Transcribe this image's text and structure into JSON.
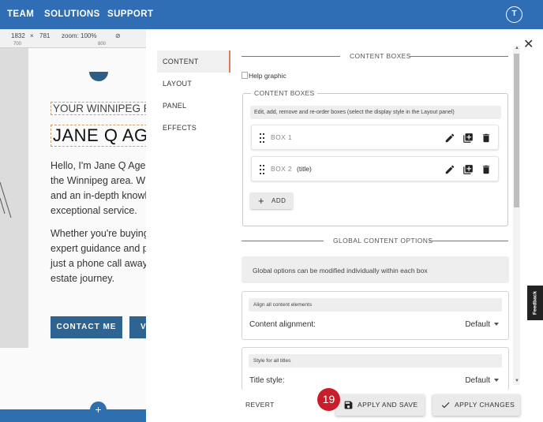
{
  "topnav": {
    "items": [
      "TEAM",
      "SOLUTIONS",
      "SUPPORT"
    ],
    "avatar": "T"
  },
  "editor_toolbar": {
    "width": "1832",
    "height": "781",
    "zoom": "zoom: 100%",
    "ruler_marks": [
      "700",
      "800"
    ]
  },
  "background_page": {
    "kicker": "YOUR WINNIPEG REAL ES",
    "name": "JANE Q AGENT",
    "paragraph1": [
      "Hello, I'm Jane Q Agent",
      "the Winnipeg area. Wit",
      "and an in-depth knowl",
      "exceptional service."
    ],
    "paragraph2": [
      "Whether you're buying",
      "expert guidance and pe",
      "just a phone call away",
      "estate journey."
    ],
    "contact_button": "CONTACT ME",
    "second_button": "V"
  },
  "panel": {
    "tabs": [
      "CONTENT",
      "LAYOUT",
      "PANEL",
      "EFFECTS"
    ],
    "active_tab": "CONTENT",
    "section_title": "CONTENT BOXES",
    "help_image_alt": "Help graphic",
    "content_boxes": {
      "legend": "CONTENT BOXES",
      "note": "Edit, add, remove and re-order boxes (select the display style in the Layout panel)",
      "boxes": [
        {
          "label": "BOX 1",
          "tag": ""
        },
        {
          "label": "BOX 2",
          "tag": "(title)"
        }
      ],
      "add_label": "ADD"
    },
    "global_section_title": "GLOBAL CONTENT OPTIONS",
    "global_note": "Global options can be modified individually within each box",
    "options": [
      {
        "header": "Align all content elements",
        "label": "Content alignment:",
        "value": "Default"
      },
      {
        "header": "Style for all titles",
        "label": "Title style:",
        "value": "Default"
      }
    ],
    "footer": {
      "revert": "REVERT",
      "apply_save": "APPLY AND SAVE",
      "apply_changes": "APPLY CHANGES"
    }
  },
  "step_badge": "19",
  "feedback_tab": "Feedback",
  "colors": {
    "nav_blue": "#2f6db5",
    "step_red": "#c81e2b",
    "active_tab_accent": "#e07a5f"
  }
}
